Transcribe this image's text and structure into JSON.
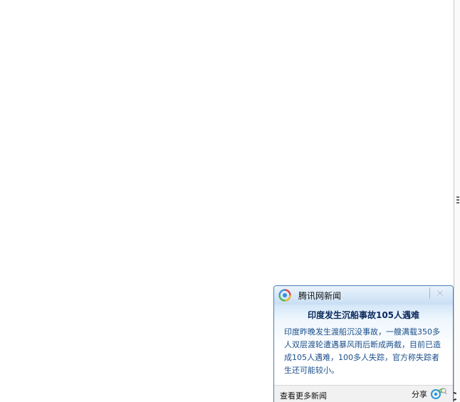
{
  "notification": {
    "app_name": "腾讯网新闻",
    "headline": "印度发生沉船事故105人遇难",
    "summary": "印度昨晚发生渡船沉没事故，一艘满载350多人双层渡轮遭遇暴风雨后断成两截，目前已造成105人遇难，100多人失踪，官方称失踪者生还可能较小。",
    "more_news_label": "查看更多新闻",
    "share_label": "分享",
    "close_icon": "close-icon",
    "logo_icon": "tencent-news-logo-icon",
    "share_icon": "share-icon"
  },
  "colors": {
    "border": "#4a7fb6",
    "headline": "#0a2a5c",
    "summary_text": "#1b4f8a",
    "header_gradient_top": "#eaf3fc",
    "header_gradient_bottom": "#c9def4"
  }
}
